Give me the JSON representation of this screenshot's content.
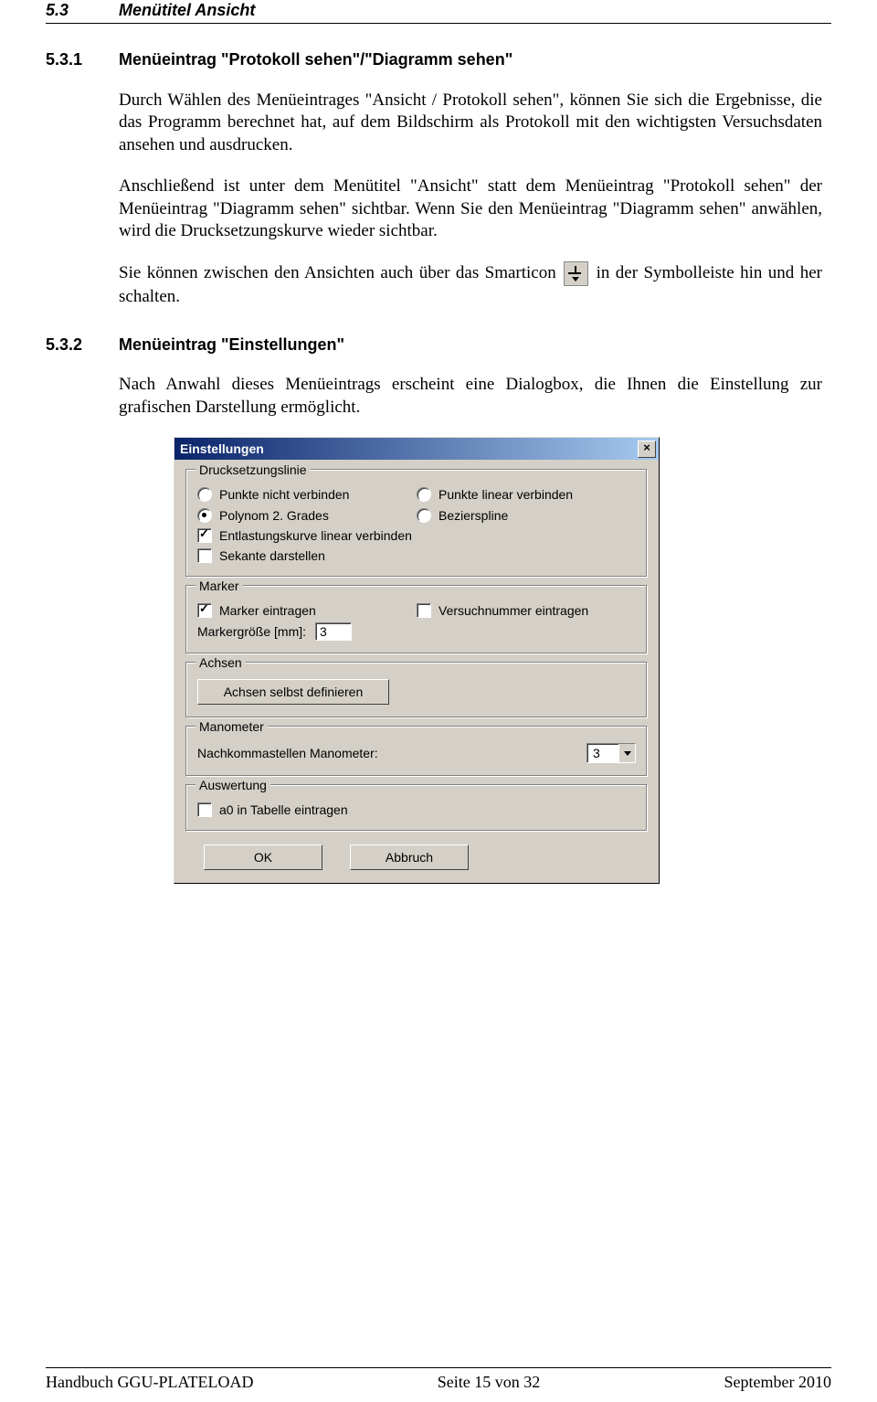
{
  "header": {
    "number": "5.3",
    "title": "Menütitel Ansicht"
  },
  "sec1": {
    "number": "5.3.1",
    "title": "Menüeintrag \"Protokoll sehen\"/\"Diagramm sehen\"",
    "p1": "Durch Wählen des Menüeintrages \"Ansicht / Protokoll sehen\", können Sie sich die Ergebnisse, die das Programm berechnet hat, auf dem Bildschirm als Protokoll mit den wichtigsten Versuchsdaten ansehen und ausdrucken.",
    "p2": "Anschließend ist unter dem Menütitel \"Ansicht\" statt dem Menüeintrag \"Protokoll sehen\" der Menüeintrag \"Diagramm sehen\" sichtbar. Wenn Sie den Menüeintrag \"Diagramm sehen\" anwählen, wird die Drucksetzungskurve wieder sichtbar.",
    "p3a": "Sie können zwischen den Ansichten auch über das Smarticon ",
    "p3b": " in der Symbolleiste hin und her schalten."
  },
  "sec2": {
    "number": "5.3.2",
    "title": "Menüeintrag \"Einstellungen\"",
    "p1": "Nach Anwahl dieses Menüeintrags erscheint eine Dialogbox, die Ihnen die Einstellung zur grafischen Darstellung ermöglicht."
  },
  "dialog": {
    "title": "Einstellungen",
    "group1": {
      "legend": "Drucksetzungslinie",
      "opt1": "Punkte nicht verbinden",
      "opt2": "Punkte linear verbinden",
      "opt3": "Polynom 2. Grades",
      "opt4": "Bezierspline",
      "chk1": "Entlastungskurve linear verbinden",
      "chk2": "Sekante darstellen"
    },
    "group2": {
      "legend": "Marker",
      "chk1": "Marker eintragen",
      "chk2": "Versuchnummer eintragen",
      "sizeLabel": "Markergröße [mm]:",
      "sizeValue": "3"
    },
    "group3": {
      "legend": "Achsen",
      "btn": "Achsen selbst definieren"
    },
    "group4": {
      "legend": "Manometer",
      "label": "Nachkommastellen Manometer:",
      "value": "3"
    },
    "group5": {
      "legend": "Auswertung",
      "chk1": "a0 in Tabelle eintragen"
    },
    "ok": "OK",
    "cancel": "Abbruch"
  },
  "footer": {
    "left": "Handbuch GGU-PLATELOAD",
    "center": "Seite 15 von 32",
    "right": "September 2010"
  }
}
